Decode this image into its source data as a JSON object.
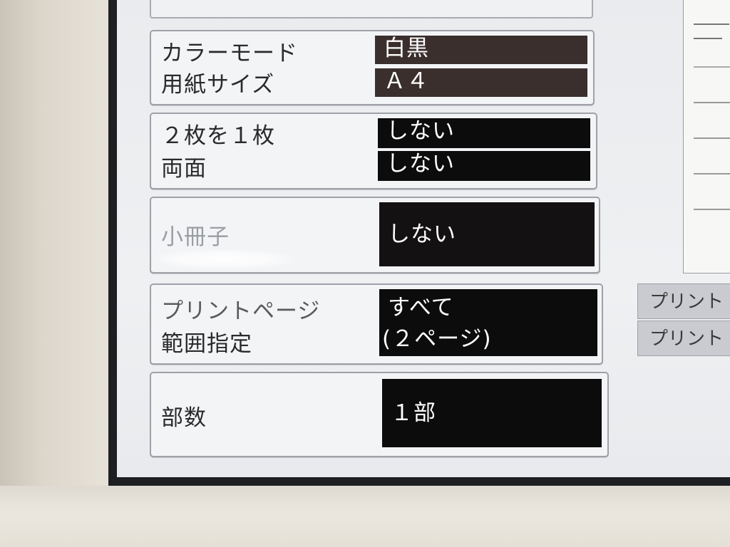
{
  "settings": {
    "color_mode": {
      "label": "カラーモード",
      "value": "白黒"
    },
    "paper_size": {
      "label": "用紙サイズ",
      "value": "Ａ４"
    },
    "two_in_one": {
      "label": "２枚を１枚",
      "value": "しない"
    },
    "duplex": {
      "label": "両面",
      "value": "しない"
    },
    "booklet": {
      "label": "小冊子",
      "value": "しない"
    },
    "page_range": {
      "label_line1": "プリントページ",
      "label_line2": "範囲指定",
      "value_line1": "すべて",
      "value_line2": "(２ページ)"
    },
    "copies": {
      "label": "部数",
      "value": "１部"
    }
  },
  "side_buttons": [
    "プリント",
    "プリント"
  ],
  "colors": {
    "value_background": "#0c0c0c",
    "bezel": "#e4dfd5",
    "panel": "#f3f4f6"
  }
}
